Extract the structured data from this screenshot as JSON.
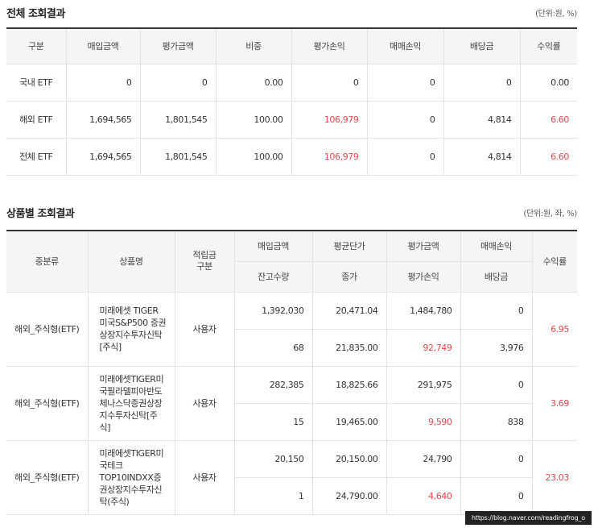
{
  "total": {
    "title": "전체 조회결과",
    "unit": "(단위:원, %)",
    "headers": [
      "구분",
      "매입금액",
      "평가금액",
      "비중",
      "평가손익",
      "매매손익",
      "배당금",
      "수익률"
    ],
    "rows": [
      [
        "국내 ETF",
        "0",
        "0",
        "0.00",
        "0",
        "0",
        "0",
        "0.00"
      ],
      [
        "해외 ETF",
        "1,694,565",
        "1,801,545",
        "100.00",
        "106,979",
        "0",
        "4,814",
        "6.60"
      ],
      [
        "전체 ETF",
        "1,694,565",
        "1,801,545",
        "100.00",
        "106,979",
        "0",
        "4,814",
        "6.60"
      ]
    ]
  },
  "products": {
    "title": "상품별 조회결과",
    "unit": "(단위:원, 좌, %)",
    "headers": {
      "category": "중분류",
      "name": "상품명",
      "type": "적립금 구분",
      "buy_amount": "매입금액",
      "avg_price": "평균단가",
      "eval_amount": "평가금액",
      "trade_pl": "매매손익",
      "return": "수익률",
      "quantity": "잔고수량",
      "close_price": "종가",
      "eval_pl": "평가손익",
      "dividend": "배당금"
    },
    "rows": [
      {
        "category": "해외_주식형(ETF)",
        "name": "미래에셋 TIGER 미국S&P500 증권상장지수투자신탁[주식]",
        "type": "사용자",
        "buy_amount": "1,392,030",
        "avg_price": "20,471.04",
        "eval_amount": "1,484,780",
        "trade_pl": "0",
        "quantity": "68",
        "close_price": "21,835.00",
        "eval_pl": "92,749",
        "dividend": "3,976",
        "return": "6.95"
      },
      {
        "category": "해외_주식형(ETF)",
        "name": "미래에셋TIGER미국필라델피아반도체나스닥증권상장지수투자신탁[주식]",
        "type": "사용자",
        "buy_amount": "282,385",
        "avg_price": "18,825.66",
        "eval_amount": "291,975",
        "trade_pl": "0",
        "quantity": "15",
        "close_price": "19,465.00",
        "eval_pl": "9,590",
        "dividend": "838",
        "return": "3.69"
      },
      {
        "category": "해외_주식형(ETF)",
        "name": "미래에셋TIGER미국테크TOP10INDXX증권상장지수투자신탁(주식)",
        "type": "사용자",
        "buy_amount": "20,150",
        "avg_price": "20,150.00",
        "eval_amount": "24,790",
        "trade_pl": "0",
        "quantity": "1",
        "close_price": "24,790.00",
        "eval_pl": "4,640",
        "dividend": "0",
        "return": "23.03"
      }
    ]
  },
  "watermark": "https://blog.naver.com/readingfrog_o",
  "colors": {
    "positive": "#e5484d",
    "header_bg": "#f5f5f5",
    "border": "#e3e3e3"
  }
}
